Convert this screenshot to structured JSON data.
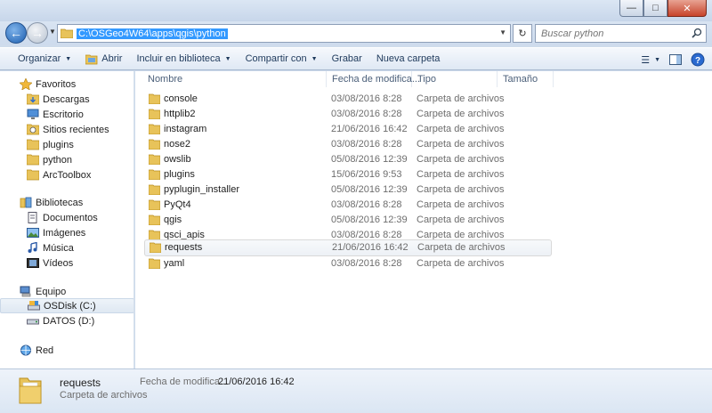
{
  "address": {
    "path": "C:\\OSGeo4W64\\apps\\qgis\\python"
  },
  "search": {
    "placeholder": "Buscar python"
  },
  "toolbar": {
    "organize": "Organizar",
    "open": "Abrir",
    "include_library": "Incluir en biblioteca",
    "share": "Compartir con",
    "burn": "Grabar",
    "new_folder": "Nueva carpeta"
  },
  "sidebar": {
    "favorites": {
      "label": "Favoritos",
      "items": [
        {
          "label": "Descargas",
          "icon": "downloads-icon"
        },
        {
          "label": "Escritorio",
          "icon": "desktop-icon"
        },
        {
          "label": "Sitios recientes",
          "icon": "recent-places-icon"
        },
        {
          "label": "plugins",
          "icon": "folder-icon"
        },
        {
          "label": "python",
          "icon": "folder-icon"
        },
        {
          "label": "ArcToolbox",
          "icon": "folder-icon"
        }
      ]
    },
    "libraries": {
      "label": "Bibliotecas",
      "items": [
        {
          "label": "Documentos",
          "icon": "documents-icon"
        },
        {
          "label": "Imágenes",
          "icon": "pictures-icon"
        },
        {
          "label": "Música",
          "icon": "music-icon"
        },
        {
          "label": "Vídeos",
          "icon": "videos-icon"
        }
      ]
    },
    "computer": {
      "label": "Equipo",
      "items": [
        {
          "label": "OSDisk (C:)",
          "icon": "drive-icon",
          "selected": true
        },
        {
          "label": "DATOS (D:)",
          "icon": "drive-icon",
          "selected": false
        }
      ]
    },
    "network": {
      "label": "Red"
    }
  },
  "columns": {
    "name": "Nombre",
    "date": "Fecha de modifica...",
    "type": "Tipo",
    "size": "Tamaño"
  },
  "files": [
    {
      "name": "console",
      "date": "03/08/2016 8:28",
      "type": "Carpeta de archivos"
    },
    {
      "name": "httplib2",
      "date": "03/08/2016 8:28",
      "type": "Carpeta de archivos"
    },
    {
      "name": "instagram",
      "date": "21/06/2016 16:42",
      "type": "Carpeta de archivos"
    },
    {
      "name": "nose2",
      "date": "03/08/2016 8:28",
      "type": "Carpeta de archivos"
    },
    {
      "name": "owslib",
      "date": "05/08/2016 12:39",
      "type": "Carpeta de archivos"
    },
    {
      "name": "plugins",
      "date": "15/06/2016 9:53",
      "type": "Carpeta de archivos"
    },
    {
      "name": "pyplugin_installer",
      "date": "05/08/2016 12:39",
      "type": "Carpeta de archivos"
    },
    {
      "name": "PyQt4",
      "date": "03/08/2016 8:28",
      "type": "Carpeta de archivos"
    },
    {
      "name": "qgis",
      "date": "05/08/2016 12:39",
      "type": "Carpeta de archivos"
    },
    {
      "name": "qsci_apis",
      "date": "03/08/2016 8:28",
      "type": "Carpeta de archivos"
    },
    {
      "name": "requests",
      "date": "21/06/2016 16:42",
      "type": "Carpeta de archivos",
      "selected": true
    },
    {
      "name": "yaml",
      "date": "03/08/2016 8:28",
      "type": "Carpeta de archivos"
    }
  ],
  "details": {
    "name": "requests",
    "type": "Carpeta de archivos",
    "date_label": "Fecha de modifica...",
    "date": "21/06/2016 16:42"
  },
  "colors": {
    "accent": "#3399ff",
    "folder": "#e8c35a",
    "link_text": "#1e395b"
  }
}
